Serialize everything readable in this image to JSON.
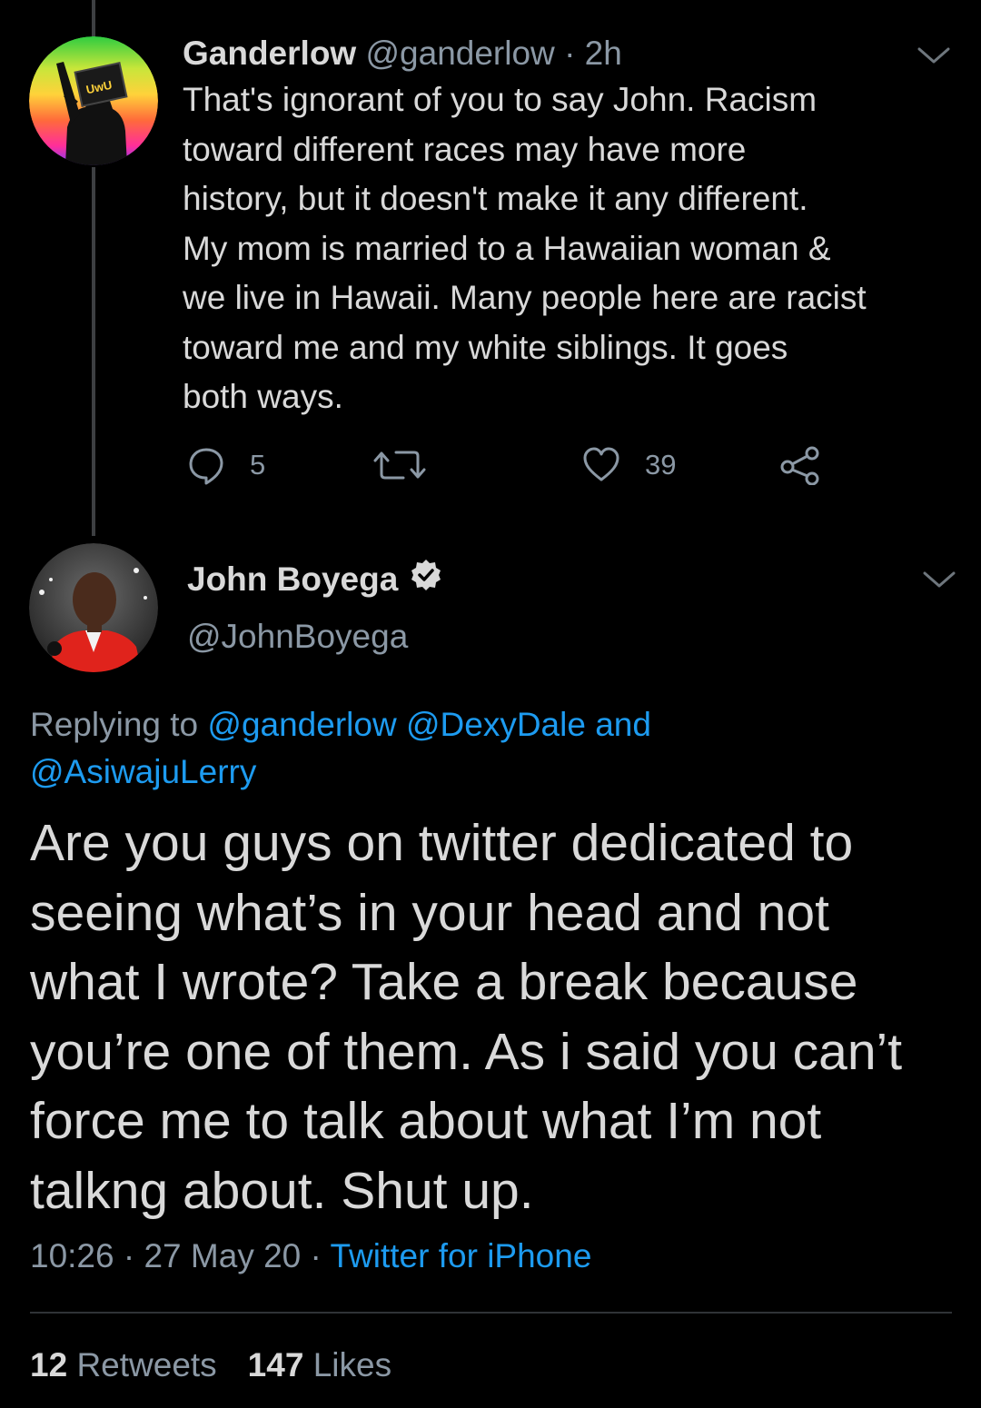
{
  "colors": {
    "background": "#000000",
    "text_primary": "#d9d9d9",
    "text_secondary": "#8b98a5",
    "link": "#1d9bf0",
    "thread_line": "#3d3f42"
  },
  "reply_tweet": {
    "avatar_icon": "rainbow-avatar-uwu-sign",
    "avatar_sign_text": "UwU",
    "name": "Ganderlow",
    "handle": "@ganderlow",
    "separator": "·",
    "time": "2h",
    "menu_icon": "chevron-down-icon",
    "lines": [
      "That's ignorant of you to say John. Racism",
      "toward different races may have more",
      "history, but it doesn't make it any different.",
      "My mom is married to a Hawaiian woman &",
      "we live in Hawaii. Many people here are racist",
      "toward me and my white siblings. It goes",
      "both ways."
    ],
    "actions": {
      "reply_count": "5",
      "retweet_count": "",
      "like_count": "39"
    }
  },
  "main_tweet": {
    "avatar_icon": "photo-avatar-john-boyega",
    "name": "John Boyega",
    "verified_icon": "verified-badge-icon",
    "handle": "@JohnBoyega",
    "menu_icon": "chevron-down-icon",
    "replying_prefix": "Replying to ",
    "replying_mentions_line1": "@ganderlow @DexyDale and",
    "replying_mentions_line2": "@AsiwajuLerry",
    "lines": [
      "Are you guys on twitter dedicated to",
      "seeing what’s in your head and not",
      "what I wrote? Take a break because",
      "you’re one of them. As i said you can’t",
      "force me to talk about what I’m not",
      "talkng about. Shut up."
    ],
    "time": "10:26",
    "date": "27 May 20",
    "separator": "·",
    "source": "Twitter for iPhone",
    "retweets_count": "12",
    "retweets_label": "Retweets",
    "likes_count": "147",
    "likes_label": "Likes"
  }
}
